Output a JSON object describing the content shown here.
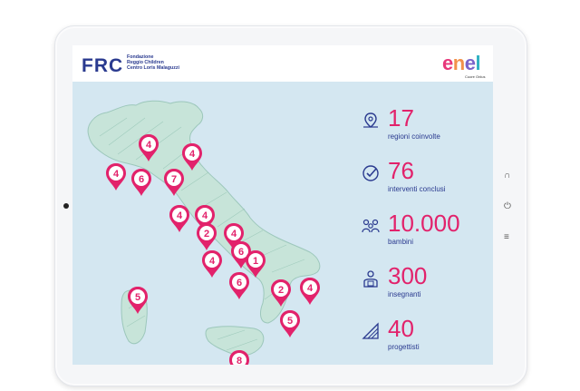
{
  "header": {
    "frc_logo_text": "FRC",
    "foundation_lines": [
      "Fondazione",
      "Reggio Children",
      "Centro Loris Malaguzzi"
    ],
    "enel_logo": [
      "e",
      "n",
      "e",
      "l"
    ],
    "enel_subtitle": "Cuore Onlus"
  },
  "stats": [
    {
      "value": "17",
      "label": "regioni coinvolte",
      "icon": "map-pin-icon"
    },
    {
      "value": "76",
      "label": "interventi conclusi",
      "icon": "check-icon"
    },
    {
      "value": "10.000",
      "label": "bambini",
      "icon": "children-icon"
    },
    {
      "value": "300",
      "label": "insegnanti",
      "icon": "teacher-icon"
    },
    {
      "value": "40",
      "label": "progettisti",
      "icon": "design-tools-icon"
    }
  ],
  "pins": [
    "4",
    "4",
    "4",
    "6",
    "7",
    "4",
    "4",
    "2",
    "4",
    "6",
    "4",
    "1",
    "6",
    "2",
    "4",
    "5",
    "5",
    "8"
  ],
  "colors": {
    "accent": "#e2226b",
    "navy": "#2a3a8f",
    "map_fill": "#c7e4d9",
    "background": "#d4e7f1"
  },
  "device_buttons": {
    "back": "∩",
    "power": "⏻",
    "menu": "≡"
  }
}
